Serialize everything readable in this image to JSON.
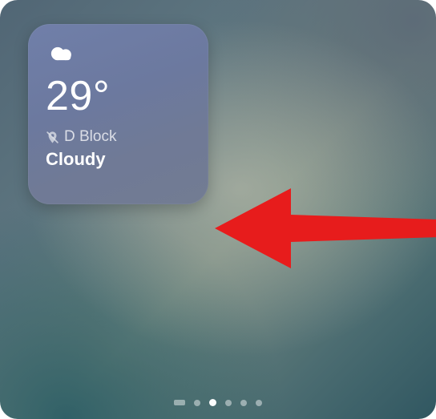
{
  "weather_widget": {
    "icon": "cloud-icon",
    "temperature": "29°",
    "location": "D Block",
    "location_services_off": true,
    "condition": "Cloudy"
  },
  "pager": {
    "pages": 6,
    "active_index": 2
  },
  "annotation": {
    "type": "arrow",
    "color": "#ef1a1a"
  }
}
